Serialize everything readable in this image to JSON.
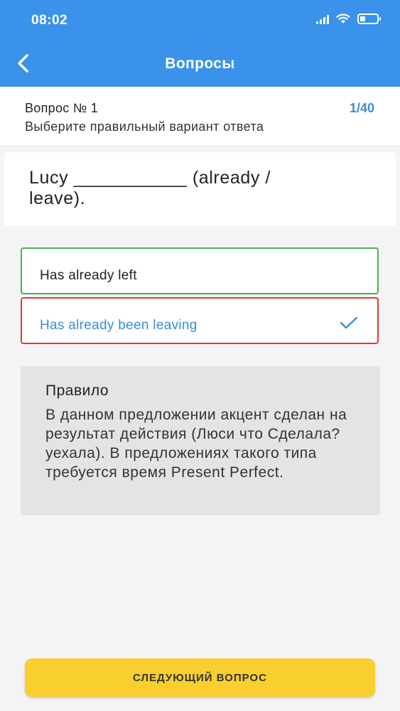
{
  "status_bar": {
    "time": "08:02"
  },
  "nav": {
    "title": "Вопросы",
    "back_icon": "chevron-left-icon"
  },
  "question_header": {
    "number": "Вопрос № 1",
    "progress": "1/40",
    "instruction": "Выберите правильный вариант ответа"
  },
  "question": {
    "text": "Lucy ___________  (already / leave)."
  },
  "answers": [
    {
      "label": "Has already left",
      "state": "correct",
      "border_color": "#4caf50"
    },
    {
      "label": "Has already been leaving",
      "state": "selected-wrong",
      "border_color": "#e53935",
      "icon": "checkmark-icon"
    }
  ],
  "rule": {
    "title": "Правило",
    "text": "В данном предложении акцент сделан на результат действия (Люси что Сделала? уехала). В предложениях такого типа требуется время Present Perfect."
  },
  "next_button": {
    "label": "СЛЕДУЮЩИЙ ВОПРОС"
  },
  "colors": {
    "accent": "#3a92ea",
    "button": "#f9cf2f"
  }
}
